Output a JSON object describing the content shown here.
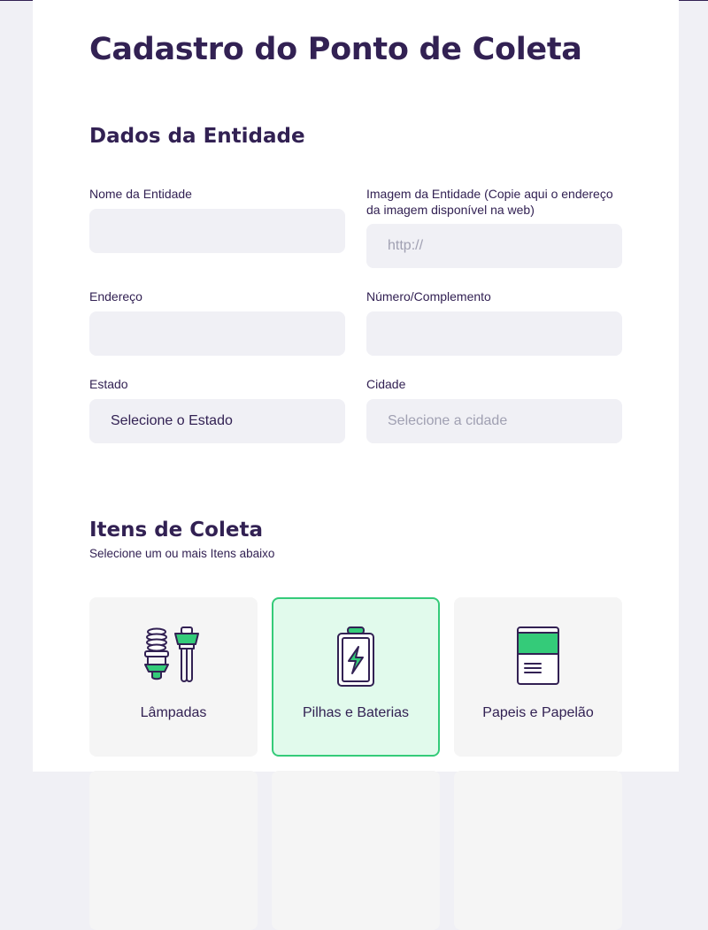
{
  "page": {
    "title": "Cadastro do Ponto de Coleta"
  },
  "entity_section": {
    "title": "Dados da Entidade",
    "fields": {
      "name": {
        "label": "Nome da Entidade",
        "value": "",
        "placeholder": ""
      },
      "image": {
        "label": "Imagem da Entidade (Copie aqui o endereço da imagem disponível na web)",
        "value": "",
        "placeholder": "http://"
      },
      "address": {
        "label": "Endereço",
        "value": "",
        "placeholder": ""
      },
      "number": {
        "label": "Número/Complemento",
        "value": "",
        "placeholder": ""
      },
      "state": {
        "label": "Estado",
        "selected": "Selecione o Estado"
      },
      "city": {
        "label": "Cidade",
        "selected": "Selecione a cidade"
      }
    }
  },
  "items_section": {
    "title": "Itens de Coleta",
    "subtitle": "Selecione um ou mais Itens abaixo",
    "items": [
      {
        "label": "Lâmpadas",
        "icon": "lamp-icon",
        "selected": false
      },
      {
        "label": "Pilhas e Baterias",
        "icon": "battery-icon",
        "selected": true
      },
      {
        "label": "Papeis e Papelão",
        "icon": "paper-icon",
        "selected": false
      }
    ]
  },
  "colors": {
    "primary": "#322153",
    "accent_green": "#34CB79",
    "selected_bg": "#E1FAEC",
    "input_bg": "#F0F0F5",
    "item_bg": "#F5F5F5"
  }
}
